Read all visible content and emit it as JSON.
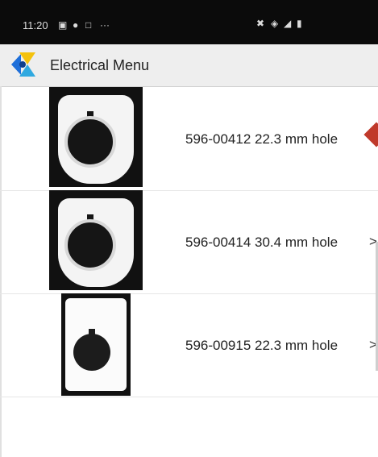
{
  "status_bar": {
    "time": "11:20",
    "left_icons": [
      "image-icon",
      "shield-icon",
      "notification-icon",
      "more-icon"
    ],
    "right_icons": [
      "mute-icon",
      "wifi-icon",
      "signal-icon",
      "battery-icon"
    ]
  },
  "app_bar": {
    "title": "Electrical Menu",
    "logo": "app-logo"
  },
  "list": {
    "items": [
      {
        "label": "596-00412 22.3 mm hole",
        "chevron": ">"
      },
      {
        "label": "596-00414 30.4 mm hole",
        "chevron": ">"
      },
      {
        "label": "596-00915 22.3 mm hole",
        "chevron": ">"
      }
    ]
  },
  "colors": {
    "status_bar_bg": "#0b0b0b",
    "app_bar_bg": "#eeeeee",
    "accent_marker": "#c0392b"
  }
}
